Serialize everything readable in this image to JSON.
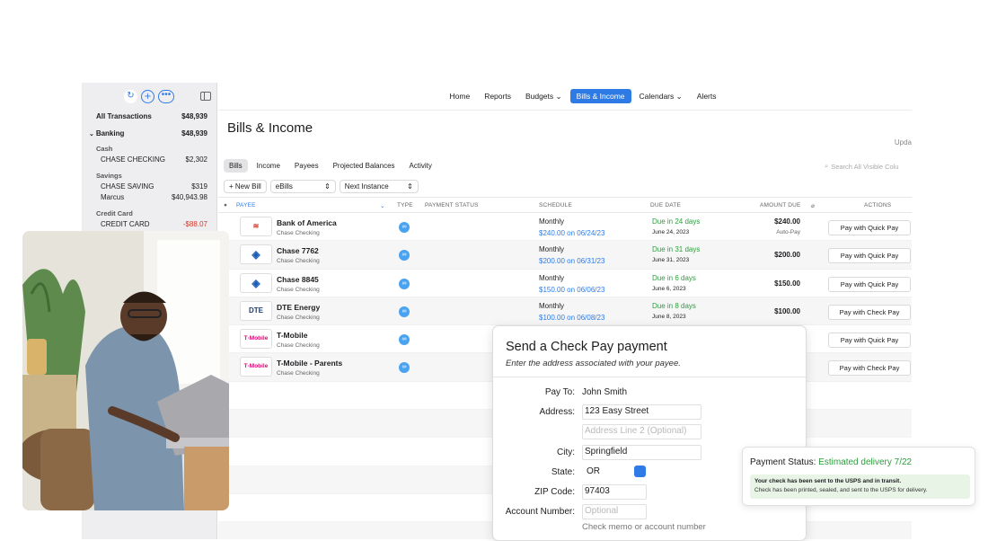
{
  "sidebar": {
    "items": [
      {
        "label": "All Transactions",
        "amount": "$48,939"
      },
      {
        "label": "Banking",
        "amount": "$48,939"
      },
      {
        "label": "Cash"
      },
      {
        "label": "CHASE CHECKING",
        "amount": "$2,302"
      },
      {
        "label": "Savings"
      },
      {
        "label": "CHASE SAVING",
        "amount": "$319"
      },
      {
        "label": "Marcus",
        "amount": "$40,943.98"
      },
      {
        "label": "Credit Card"
      },
      {
        "label": "CREDIT CARD",
        "amount": "-$88.07"
      }
    ]
  },
  "nav": {
    "items": [
      "Home",
      "Reports",
      "Budgets",
      "Bills & Income",
      "Calendars",
      "Alerts"
    ],
    "active": "Bills & Income"
  },
  "page": {
    "title": "Bills & Income",
    "update": "Upda"
  },
  "tabs": [
    "Bills",
    "Income",
    "Payees",
    "Projected Balances",
    "Activity"
  ],
  "search": {
    "placeholder": "Search All Visible Colu"
  },
  "toolbar": {
    "new_bill": "+ New Bill",
    "filter1": "eBills",
    "filter2": "Next Instance"
  },
  "table": {
    "headers": {
      "bullet": "●",
      "payee": "PAYEE",
      "type": "TYPE",
      "status": "PAYMENT STATUS",
      "schedule": "SCHEDULE",
      "due": "DUE DATE",
      "amount": "AMOUNT DUE",
      "actions": "ACTIONS"
    },
    "rows": [
      {
        "logo": "",
        "payee": "Bank of America",
        "account": "Chase Checking",
        "freq": "Monthly",
        "sched": "$240.00 on 06/24/23",
        "due_rel": "Due in 24 days",
        "due_date": "June 24, 2023",
        "amount": "$240.00",
        "autopay": "Auto-Pay",
        "action": "Pay with Quick Pay"
      },
      {
        "logo": "",
        "payee": "Chase 7762",
        "account": "Chase Checking",
        "freq": "Monthly",
        "sched": "$200.00 on 06/31/23",
        "due_rel": "Due in 31 days",
        "due_date": "June 31, 2023",
        "amount": "$200.00",
        "action": "Pay with Quick Pay"
      },
      {
        "logo": "",
        "payee": "Chase 8845",
        "account": "Chase Checking",
        "freq": "Monthly",
        "sched": "$150.00 on 06/06/23",
        "due_rel": "Due in 6 days",
        "due_date": "June 6, 2023",
        "amount": "$150.00",
        "action": "Pay with Quick Pay"
      },
      {
        "logo": "DTE",
        "payee": "DTE Energy",
        "account": "Chase Checking",
        "freq": "Monthly",
        "sched": "$100.00 on 06/08/23",
        "due_rel": "Due in 8 days",
        "due_date": "June 8, 2023",
        "amount": "$100.00",
        "action": "Pay with Check Pay"
      },
      {
        "logo": "T·Mobile",
        "payee": "T-Mobile",
        "account": "Chase Checking",
        "action": "Pay with Quick Pay"
      },
      {
        "logo": "T·Mobile",
        "payee": "T-Mobile - Parents",
        "account": "Chase Checking",
        "action": "Pay with Check Pay"
      }
    ]
  },
  "modal": {
    "title": "Send a Check Pay payment",
    "subtitle": "Enter the address associated with your payee.",
    "pay_to_label": "Pay To:",
    "pay_to_value": "John Smith",
    "address_label": "Address:",
    "address1": "123 Easy Street",
    "address2_placeholder": "Address Line 2 (Optional)",
    "city_label": "City:",
    "city": "Springfield",
    "state_label": "State:",
    "state": "OR",
    "zip_label": "ZIP Code:",
    "zip": "97403",
    "account_label": "Account Number:",
    "account_placeholder": "Optional",
    "account_note": "Check memo or account number"
  },
  "status": {
    "label": "Payment Status:",
    "value": "Estimated delivery 7/22",
    "line1": "Your check has been sent to the USPS and in transit.",
    "line2": "Check has been printed, sealed, and sent to the USPS for delivery."
  },
  "colors": {
    "accent": "#2f7be6",
    "success": "#2c9d3d",
    "negative": "#d0392b"
  }
}
